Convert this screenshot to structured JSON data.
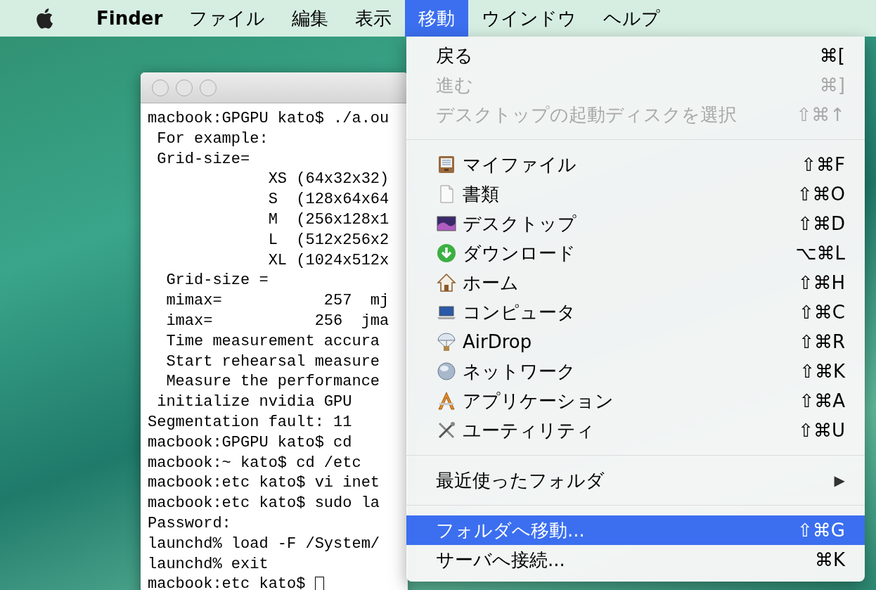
{
  "menu_bar": [
    {
      "label": "Finder",
      "selected": false
    },
    {
      "label": "ファイル",
      "selected": false
    },
    {
      "label": "編集",
      "selected": false
    },
    {
      "label": "表示",
      "selected": false
    },
    {
      "label": "移動",
      "selected": true
    },
    {
      "label": "ウインドウ",
      "selected": false
    },
    {
      "label": "ヘルプ",
      "selected": false
    }
  ],
  "terminal": {
    "lines": [
      "macbook:GPGPU kato$ ./a.ou",
      " For example:",
      " Grid-size=",
      "             XS (64x32x32)",
      "             S  (128x64x64",
      "             M  (256x128x1",
      "             L  (512x256x2",
      "             XL (1024x512x",
      "  Grid-size =",
      "  mimax=           257  mj",
      "  imax=           256  jma",
      "  Time measurement accura",
      "  Start rehearsal measure",
      "  Measure the performance",
      " initialize nvidia GPU",
      "Segmentation fault: 11",
      "macbook:GPGPU kato$ cd",
      "macbook:~ kato$ cd /etc",
      "macbook:etc kato$ vi inet",
      "macbook:etc kato$ sudo la",
      "Password:",
      "launchd% load -F /System/",
      "launchd% exit",
      "macbook:etc kato$ "
    ]
  },
  "menu": [
    {
      "kind": "command",
      "label": "戻る",
      "shortcut": "⌘[",
      "disabled": false,
      "selected": false
    },
    {
      "kind": "command",
      "label": "進む",
      "shortcut": "⌘]",
      "disabled": true,
      "selected": false
    },
    {
      "kind": "command",
      "label": "デスクトップの起動ディスクを選択",
      "shortcut": "⇧⌘↑",
      "disabled": true,
      "selected": false
    },
    {
      "kind": "separator"
    },
    {
      "kind": "place",
      "label": "マイファイル",
      "shortcut": "⇧⌘F",
      "disabled": false,
      "selected": false
    },
    {
      "kind": "place",
      "label": "書類",
      "shortcut": "⇧⌘O",
      "disabled": false,
      "selected": false
    },
    {
      "kind": "place",
      "label": "デスクトップ",
      "shortcut": "⇧⌘D",
      "disabled": false,
      "selected": false
    },
    {
      "kind": "place",
      "label": "ダウンロード",
      "shortcut": "⌥⌘L",
      "disabled": false,
      "selected": false
    },
    {
      "kind": "place",
      "label": "ホーム",
      "shortcut": "⇧⌘H",
      "disabled": false,
      "selected": false
    },
    {
      "kind": "place",
      "label": "コンピュータ",
      "shortcut": "⇧⌘C",
      "disabled": false,
      "selected": false
    },
    {
      "kind": "place",
      "label": "AirDrop",
      "shortcut": "⇧⌘R",
      "disabled": false,
      "selected": false
    },
    {
      "kind": "place",
      "label": "ネットワーク",
      "shortcut": "⇧⌘K",
      "disabled": false,
      "selected": false
    },
    {
      "kind": "place",
      "label": "アプリケーション",
      "shortcut": "⇧⌘A",
      "disabled": false,
      "selected": false
    },
    {
      "kind": "place",
      "label": "ユーティリティ",
      "shortcut": "⇧⌘U",
      "disabled": false,
      "selected": false
    },
    {
      "kind": "separator"
    },
    {
      "kind": "submenu",
      "label": "最近使ったフォルダ",
      "arrow": "▶",
      "disabled": false,
      "selected": false
    },
    {
      "kind": "separator"
    },
    {
      "kind": "command",
      "label": "フォルダへ移動...",
      "shortcut": "⇧⌘G",
      "disabled": false,
      "selected": true
    },
    {
      "kind": "command",
      "label": "サーバへ接続...",
      "shortcut": "⌘K",
      "disabled": false,
      "selected": false
    }
  ]
}
